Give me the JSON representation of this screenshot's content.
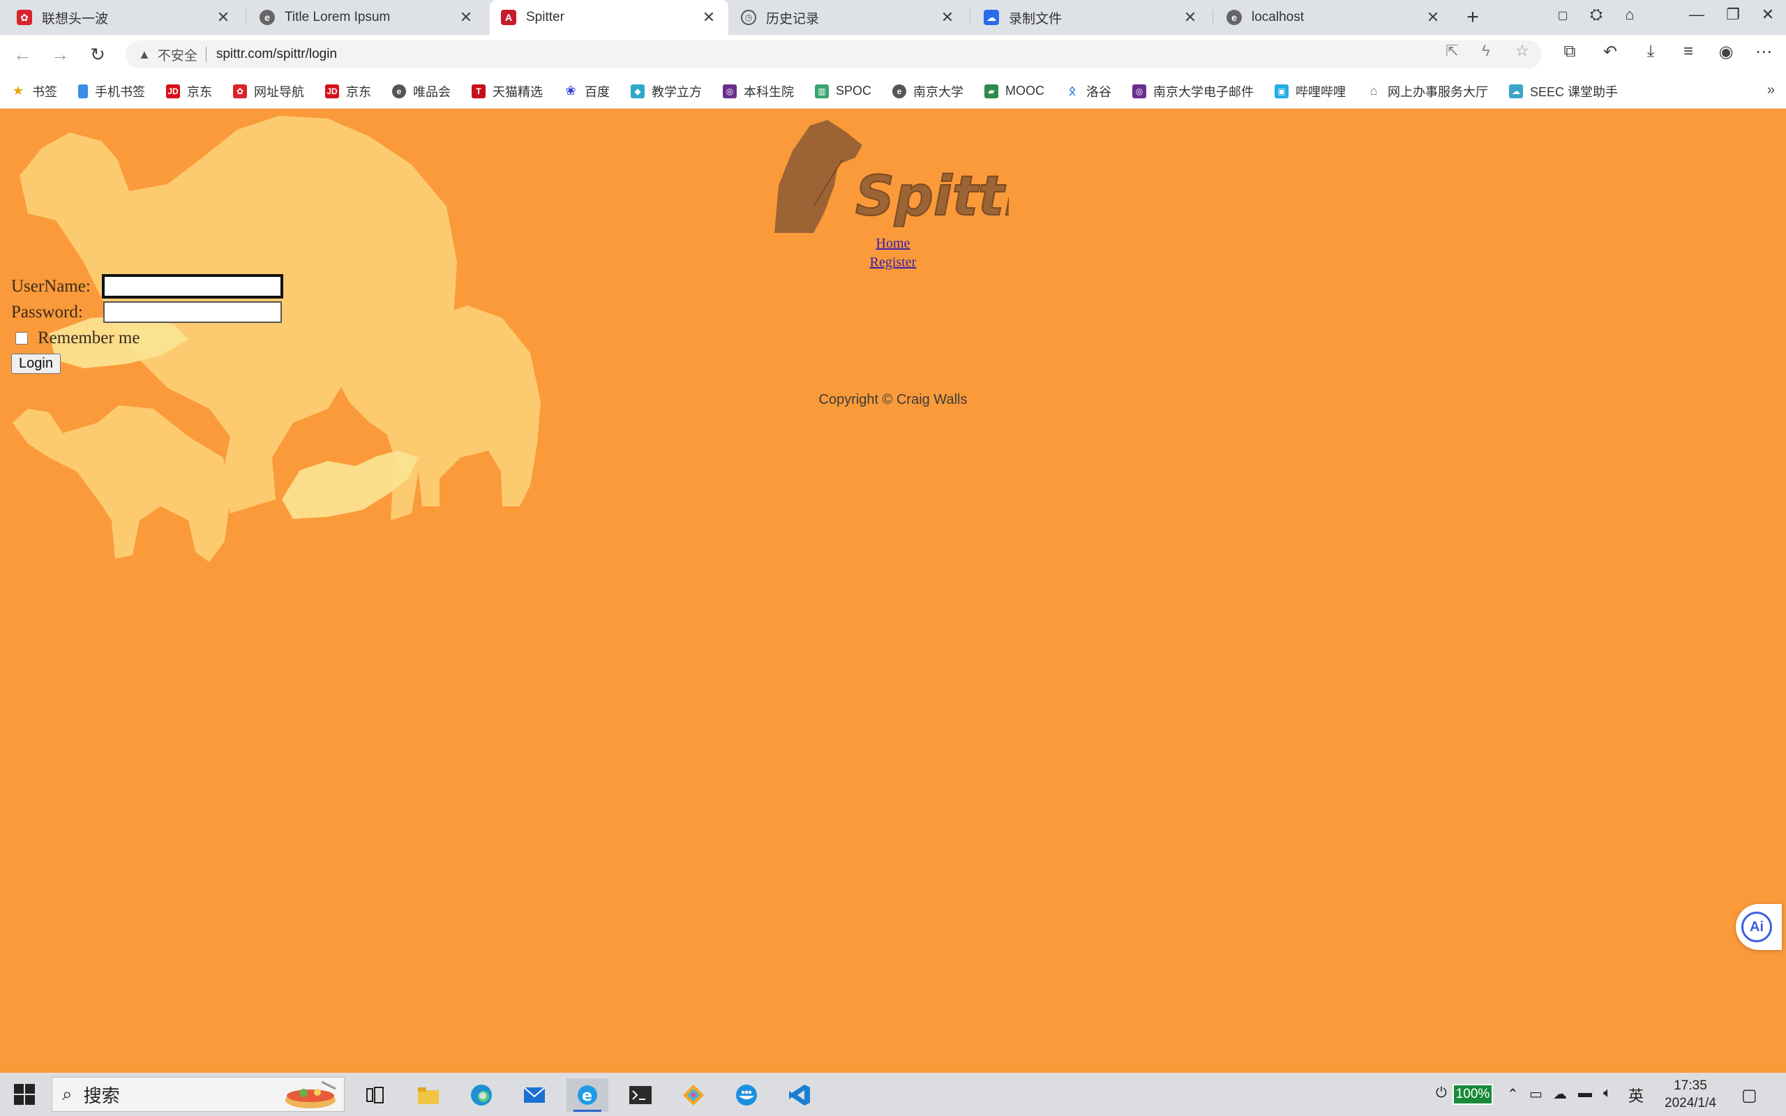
{
  "browser": {
    "tabs": [
      {
        "title": "联想头一波",
        "active": false
      },
      {
        "title": "Title Lorem Ipsum",
        "active": false
      },
      {
        "title": "Spitter",
        "active": true
      },
      {
        "title": "历史记录",
        "active": false
      },
      {
        "title": "录制文件",
        "active": false
      },
      {
        "title": "localhost",
        "active": false
      }
    ],
    "new_tab": "+",
    "address": {
      "security_label": "不安全",
      "url": "spittr.com/spittr/login"
    },
    "bookmarks": [
      "书签",
      "手机书签",
      "京东",
      "网址导航",
      "京东",
      "唯品会",
      "天猫精选",
      "百度",
      "教学立方",
      "本科生院",
      "SPOC",
      "南京大学",
      "MOOC",
      "洛谷",
      "南京大学电子邮件",
      "哔哩哔哩",
      "网上办事服务大厅",
      "SEEC 课堂助手"
    ],
    "bookmarks_more": "»"
  },
  "page": {
    "logo_text": "Spittr",
    "nav": {
      "home": "Home",
      "register": "Register"
    },
    "form": {
      "username_label": "UserName:",
      "password_label": "Password:",
      "username_value": "",
      "password_value": "",
      "remember_label": "Remember me",
      "remember_checked": false,
      "login_button": "Login"
    },
    "copyright": "Copyright © Craig Walls",
    "ai_button": "Ai"
  },
  "taskbar": {
    "search_placeholder": "搜索",
    "battery": "100%",
    "ime": "英",
    "time": "17:35",
    "date": "2024/1/4"
  },
  "colors": {
    "page_bg": "#fb9a3a",
    "camel_light": "#fccb70",
    "logo_brown": "#9c6434",
    "link": "#3b1fa8"
  },
  "icons": {
    "back": "arrow-left-icon",
    "forward": "arrow-right-icon",
    "reload": "reload-icon",
    "warning": "warning-icon",
    "star": "star-icon"
  }
}
